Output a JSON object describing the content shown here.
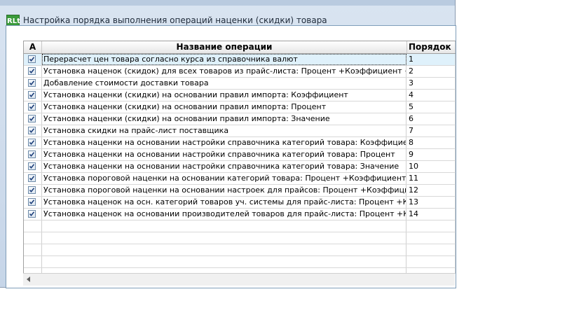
{
  "window": {
    "icon_text": "RLt",
    "title": "Настройка порядка выполнения операций наценки (скидки) товара"
  },
  "grid": {
    "columns": [
      "A",
      "Название операции",
      "Порядок"
    ],
    "rows": [
      {
        "active": true,
        "name": "Перерасчет цен товара согласно курса из справочника валют",
        "order": "1"
      },
      {
        "active": true,
        "name": "Установка наценок (скидок) для всех товаров из прайс-листа: Процент +Коэффициент +Значение",
        "order": "2"
      },
      {
        "active": true,
        "name": "Добавление стоимости доставки товара",
        "order": "3"
      },
      {
        "active": true,
        "name": "Установка наценки (скидки) на основании правил импорта: Коэффициент",
        "order": "4"
      },
      {
        "active": true,
        "name": "Установка наценки (скидки) на основании правил импорта: Процент",
        "order": "5"
      },
      {
        "active": true,
        "name": "Установка наценки (скидки) на основании правил импорта: Значение",
        "order": "6"
      },
      {
        "active": true,
        "name": "Установка скидки на прайс-лист поставщика",
        "order": "7"
      },
      {
        "active": true,
        "name": "Установка наценки на основании настройки справочника категорий товара: Коэффициент",
        "order": "8"
      },
      {
        "active": true,
        "name": "Установка наценки на основании настройки справочника категорий товара: Процент",
        "order": "9"
      },
      {
        "active": true,
        "name": "Установка наценки на основании настройки справочника категорий товара: Значение",
        "order": "10"
      },
      {
        "active": true,
        "name": "Установка пороговой наценки на основании категорий товара: Процент +Коэффициент +Значение",
        "order": "11"
      },
      {
        "active": true,
        "name": "Установка пороговой наценки на основании настроек для прайсов: Процент +Коэффициент +Значение",
        "order": "12"
      },
      {
        "active": true,
        "name": "Установка наценок на осн. категорий товаров уч. системы для прайс-листа: Процент +Коэффициент",
        "order": "13"
      },
      {
        "active": true,
        "name": "Установка наценок на основании производителей товаров для прайс-листа: Процент +Коэффициент",
        "order": "14"
      }
    ],
    "empty_rows": 6
  }
}
